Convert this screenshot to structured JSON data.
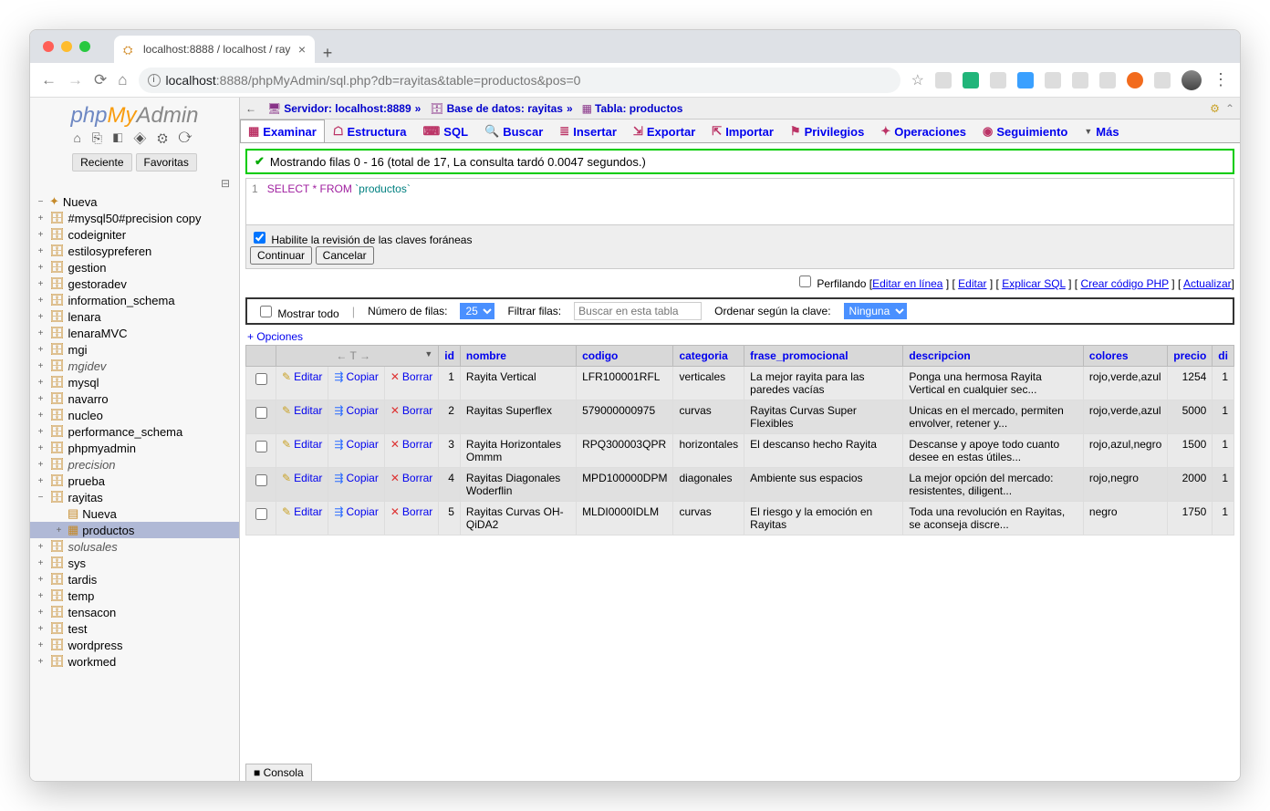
{
  "browser": {
    "tab_title": "localhost:8888 / localhost / ray",
    "url_host": "localhost",
    "url_rest": ":8888/phpMyAdmin/sql.php?db=rayitas&table=productos&pos=0"
  },
  "sidebar": {
    "logo_php": "php",
    "logo_my": "My",
    "logo_admin": "Admin",
    "recent": "Reciente",
    "favorites": "Favoritas",
    "new": "Nueva",
    "databases": [
      "#mysql50#precision copy",
      "codeigniter",
      "estilosypreferen",
      "gestion",
      "gestoradev",
      "information_schema",
      "lenara",
      "lenaraMVC",
      "mgi",
      "mgidev",
      "mysql",
      "navarro",
      "nucleo",
      "performance_schema",
      "phpmyadmin",
      "precision",
      "prueba",
      "rayitas",
      "solusales",
      "sys",
      "tardis",
      "temp",
      "tensacon",
      "test",
      "wordpress",
      "workmed"
    ],
    "rayitas_children": {
      "new": "Nueva",
      "table": "productos"
    }
  },
  "crumbs": {
    "server_lbl": "Servidor:",
    "server": "localhost:8889",
    "db_lbl": "Base de datos:",
    "db": "rayitas",
    "table_lbl": "Tabla:",
    "table": "productos"
  },
  "tabs": {
    "examinar": "Examinar",
    "estructura": "Estructura",
    "sql": "SQL",
    "buscar": "Buscar",
    "insertar": "Insertar",
    "exportar": "Exportar",
    "importar": "Importar",
    "privilegios": "Privilegios",
    "operaciones": "Operaciones",
    "seguimiento": "Seguimiento",
    "mas": "Más"
  },
  "success_msg": "Mostrando filas 0 - 16 (total de 17, La consulta tardó 0.0047 segundos.)",
  "sql": {
    "line": "1",
    "kw": "SELECT * FROM ",
    "ident": "`productos`"
  },
  "fk_label": "Habilite la revisión de las claves foráneas",
  "continuar": "Continuar",
  "cancelar": "Cancelar",
  "profiling": {
    "perfilando": "Perfilando",
    "editar_linea": "Editar en línea",
    "editar": "Editar",
    "explicar": "Explicar SQL",
    "crear_php": "Crear código PHP",
    "actualizar": "Actualizar"
  },
  "ctrlbar": {
    "mostrar_todo": "Mostrar todo",
    "num_filas": "Número de filas:",
    "num_filas_val": "25",
    "filtrar": "Filtrar filas:",
    "filtrar_placeholder": "Buscar en esta tabla",
    "ordenar": "Ordenar según la clave:",
    "ordenar_val": "Ninguna"
  },
  "options_label": "+ Opciones",
  "table": {
    "actions": {
      "edit": "Editar",
      "copy": "Copiar",
      "del": "Borrar"
    },
    "headers": [
      "id",
      "nombre",
      "codigo",
      "categoria",
      "frase_promocional",
      "descripcion",
      "colores",
      "precio",
      "di"
    ],
    "rows": [
      {
        "id": "1",
        "nombre": "Rayita Vertical",
        "codigo": "LFR100001RFL",
        "categoria": "verticales",
        "frase": "La mejor rayita para las paredes vacías",
        "desc": "Ponga una hermosa Rayita Vertical en cualquier sec...",
        "colores": "rojo,verde,azul",
        "precio": "1254",
        "di": "1"
      },
      {
        "id": "2",
        "nombre": "Rayitas Superflex",
        "codigo": "579000000975",
        "categoria": "curvas",
        "frase": "Rayitas Curvas Super Flexibles",
        "desc": "Unicas en el mercado, permiten envolver, retener y...",
        "colores": "rojo,verde,azul",
        "precio": "5000",
        "di": "1"
      },
      {
        "id": "3",
        "nombre": "Rayita Horizontales Ommm",
        "codigo": "RPQ300003QPR",
        "categoria": "horizontales",
        "frase": "El descanso hecho Rayita",
        "desc": "Descanse y apoye todo cuanto desee en estas útiles...",
        "colores": "rojo,azul,negro",
        "precio": "1500",
        "di": "1"
      },
      {
        "id": "4",
        "nombre": "Rayitas Diagonales Woderflin",
        "codigo": "MPD100000DPM",
        "categoria": "diagonales",
        "frase": "Ambiente sus espacios",
        "desc": "La mejor opción del mercado: resistentes, diligent...",
        "colores": "rojo,negro",
        "precio": "2000",
        "di": "1"
      },
      {
        "id": "5",
        "nombre": "Rayitas Curvas OH-QiDA2",
        "codigo": "MLDI0000IDLM",
        "categoria": "curvas",
        "frase": "El riesgo y la emoción en Rayitas",
        "desc": "Toda una revolución en Rayitas, se aconseja discre...",
        "colores": "negro",
        "precio": "1750",
        "di": "1"
      }
    ]
  },
  "consola": "Consola"
}
